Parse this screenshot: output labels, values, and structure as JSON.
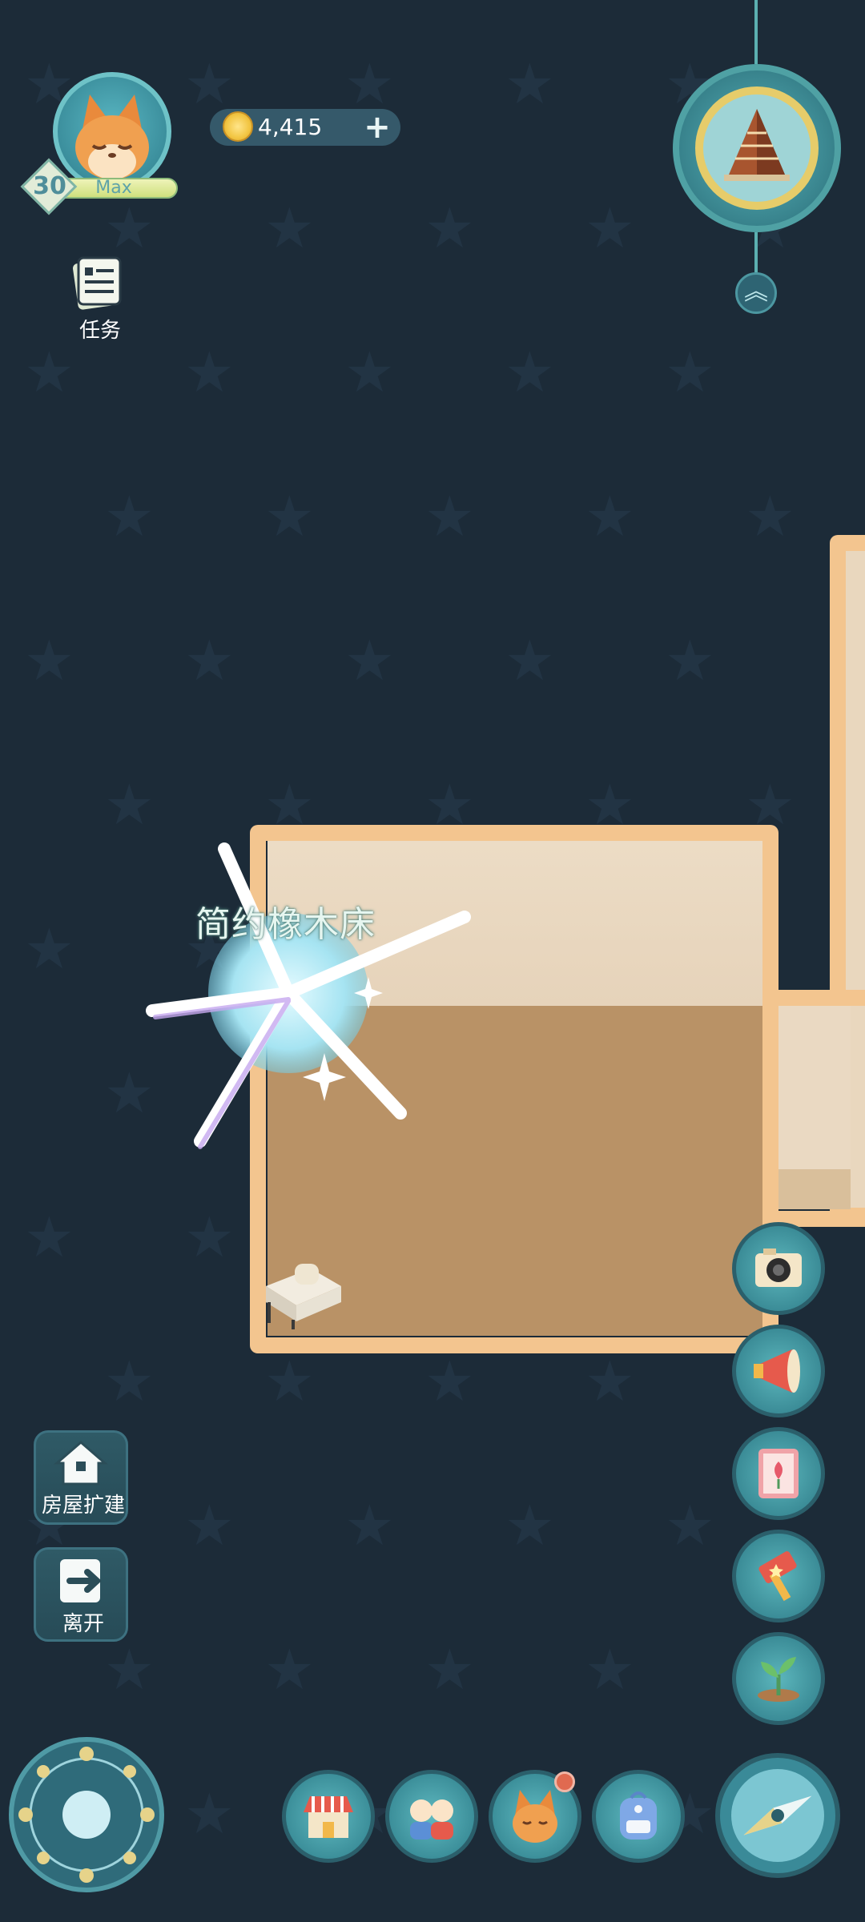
{
  "player": {
    "level": "30",
    "level_status": "Max",
    "avatar_icon": "fox-avatar-icon"
  },
  "currency": {
    "coins": "4,415",
    "add_label": "+"
  },
  "quest": {
    "label": "任务"
  },
  "placement": {
    "item_name": "简约橡木床"
  },
  "left_menu": {
    "expand_house_label": "房屋扩建",
    "leave_label": "离开"
  },
  "right_menu": [
    "camera-icon",
    "megaphone-icon",
    "flower-book-icon",
    "hammer-icon",
    "sprout-icon"
  ],
  "bottom_bar": [
    "shop-icon",
    "friends-icon",
    "fox-icon",
    "backpack-icon"
  ],
  "colors": {
    "background": "#1c2b38",
    "room_border": "#f3c58f",
    "floor": "#b99266",
    "wall": "#ecdcc5",
    "accent": "#3b8c97"
  }
}
